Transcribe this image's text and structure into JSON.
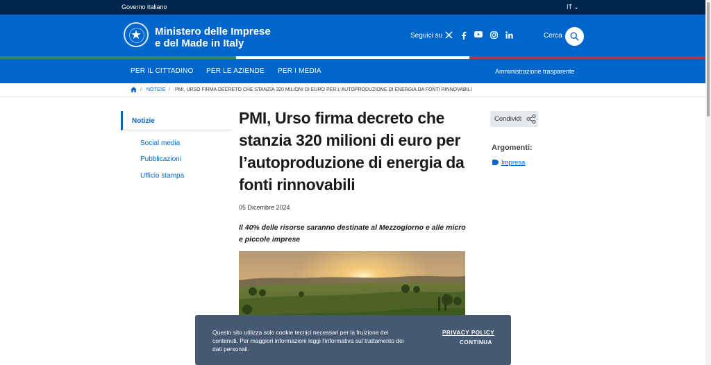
{
  "topbar": {
    "gov_link": "Governo italiano",
    "lang": "IT ⌄"
  },
  "header": {
    "ministry_line1": "Ministero delle Imprese",
    "ministry_line2": "e del Made in Italy",
    "follow_label": "Seguici su",
    "social": [
      "x-icon",
      "facebook-icon",
      "youtube-icon",
      "instagram-icon",
      "linkedin-icon"
    ],
    "search_label": "Cerca"
  },
  "nav": {
    "items": [
      "PER IL CITTADINO",
      "PER LE AZIENDE",
      "PER I MEDIA"
    ],
    "right": "Amministrazione trasparente"
  },
  "breadcrumb": {
    "sep": "/",
    "section": "NOTIZIE",
    "current": "PMI, URSO FIRMA DECRETO CHE STANZIA 320 MILIONI DI EURO PER L'AUTOPRODUZIONE DI ENERGIA DA FONTI RINNOVABILI"
  },
  "sidebar": {
    "active": "Notizie",
    "links": [
      "Social media",
      "Pubblicazioni",
      "Ufficio stampa"
    ]
  },
  "article": {
    "title": "PMI, Urso firma decreto che stanzia 320 milioni di euro per l’autoproduzione di energia da fonti rinnovabili",
    "date": "05 Dicembre 2024",
    "subtitle": "Il 40% delle risorse saranno destinate al Mezzogiorno e alle micro e piccole imprese"
  },
  "aside": {
    "share_label": "Condividi",
    "topics_label": "Argomenti:",
    "tag": "Impresa"
  },
  "cookie": {
    "text": "Questo sito utilizza solo cookie tecnici necessari per la fruizione dei contenuti. Per maggiori informazioni leggi l'informativa sul trattamento dei dati personali.",
    "privacy": "PRIVACY POLICY",
    "continue": "CONTINUA"
  },
  "colors": {
    "primary": "#0066cc",
    "topbar": "#00264d",
    "cookie_bg": "#455a72"
  }
}
